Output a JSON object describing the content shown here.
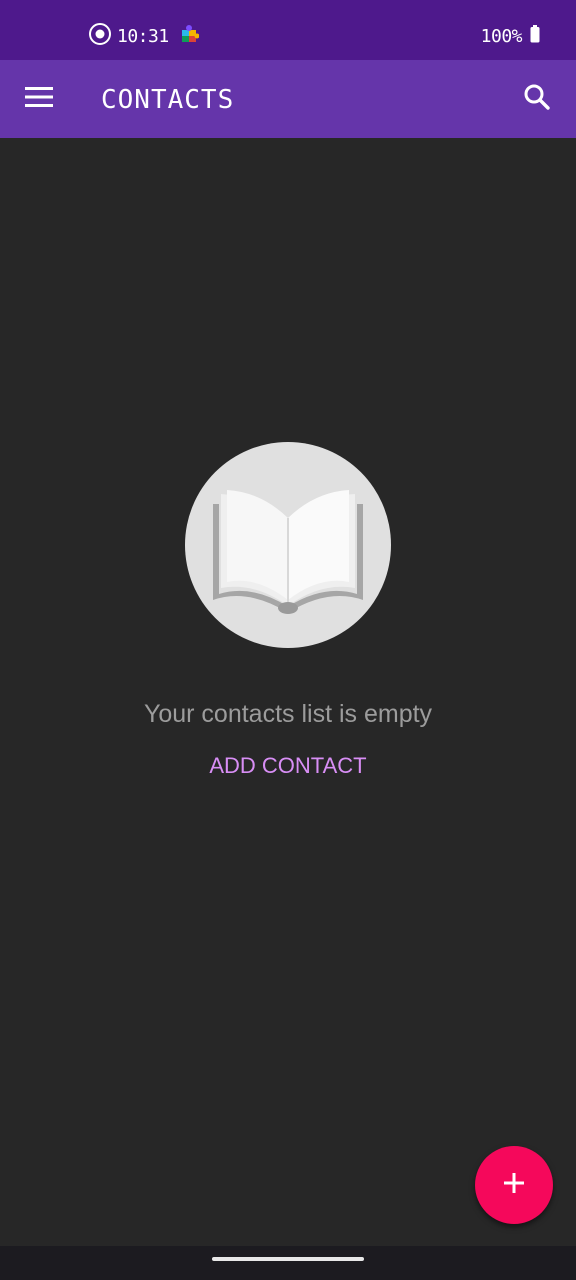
{
  "status_bar": {
    "time": "10:31",
    "battery_text": "100%",
    "icons": [
      "record-icon",
      "puzzle-app-icon",
      "battery-icon"
    ]
  },
  "app_bar": {
    "title": "CONTACTS",
    "menu_icon": "hamburger-menu-icon",
    "search_icon": "search-icon"
  },
  "empty_state": {
    "illustration": "open-book-icon",
    "message": "Your contacts list is empty",
    "action_label": "ADD CONTACT"
  },
  "fab": {
    "icon": "plus-icon"
  },
  "colors": {
    "status_bar": "#4e198c",
    "app_bar": "#6535aa",
    "background": "#272727",
    "accent_text": "#d88ef5",
    "fab": "#f5085b"
  }
}
